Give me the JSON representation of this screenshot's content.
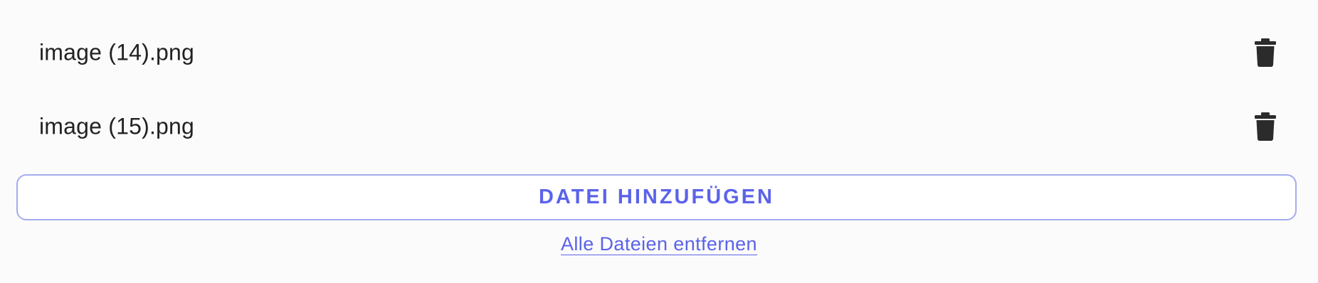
{
  "files": [
    {
      "name": "image (14).png",
      "delete_icon": "trash-icon"
    },
    {
      "name": "image (15).png",
      "delete_icon": "trash-icon"
    }
  ],
  "actions": {
    "add_file_label": "DATEI HINZUFÜGEN",
    "remove_all_label": "Alle Dateien entfernen"
  },
  "colors": {
    "accent": "#5b63e8",
    "button_border": "#a6acef",
    "text": "#222222",
    "icon": "#2b2b2b",
    "background": "#fbfbfb"
  }
}
